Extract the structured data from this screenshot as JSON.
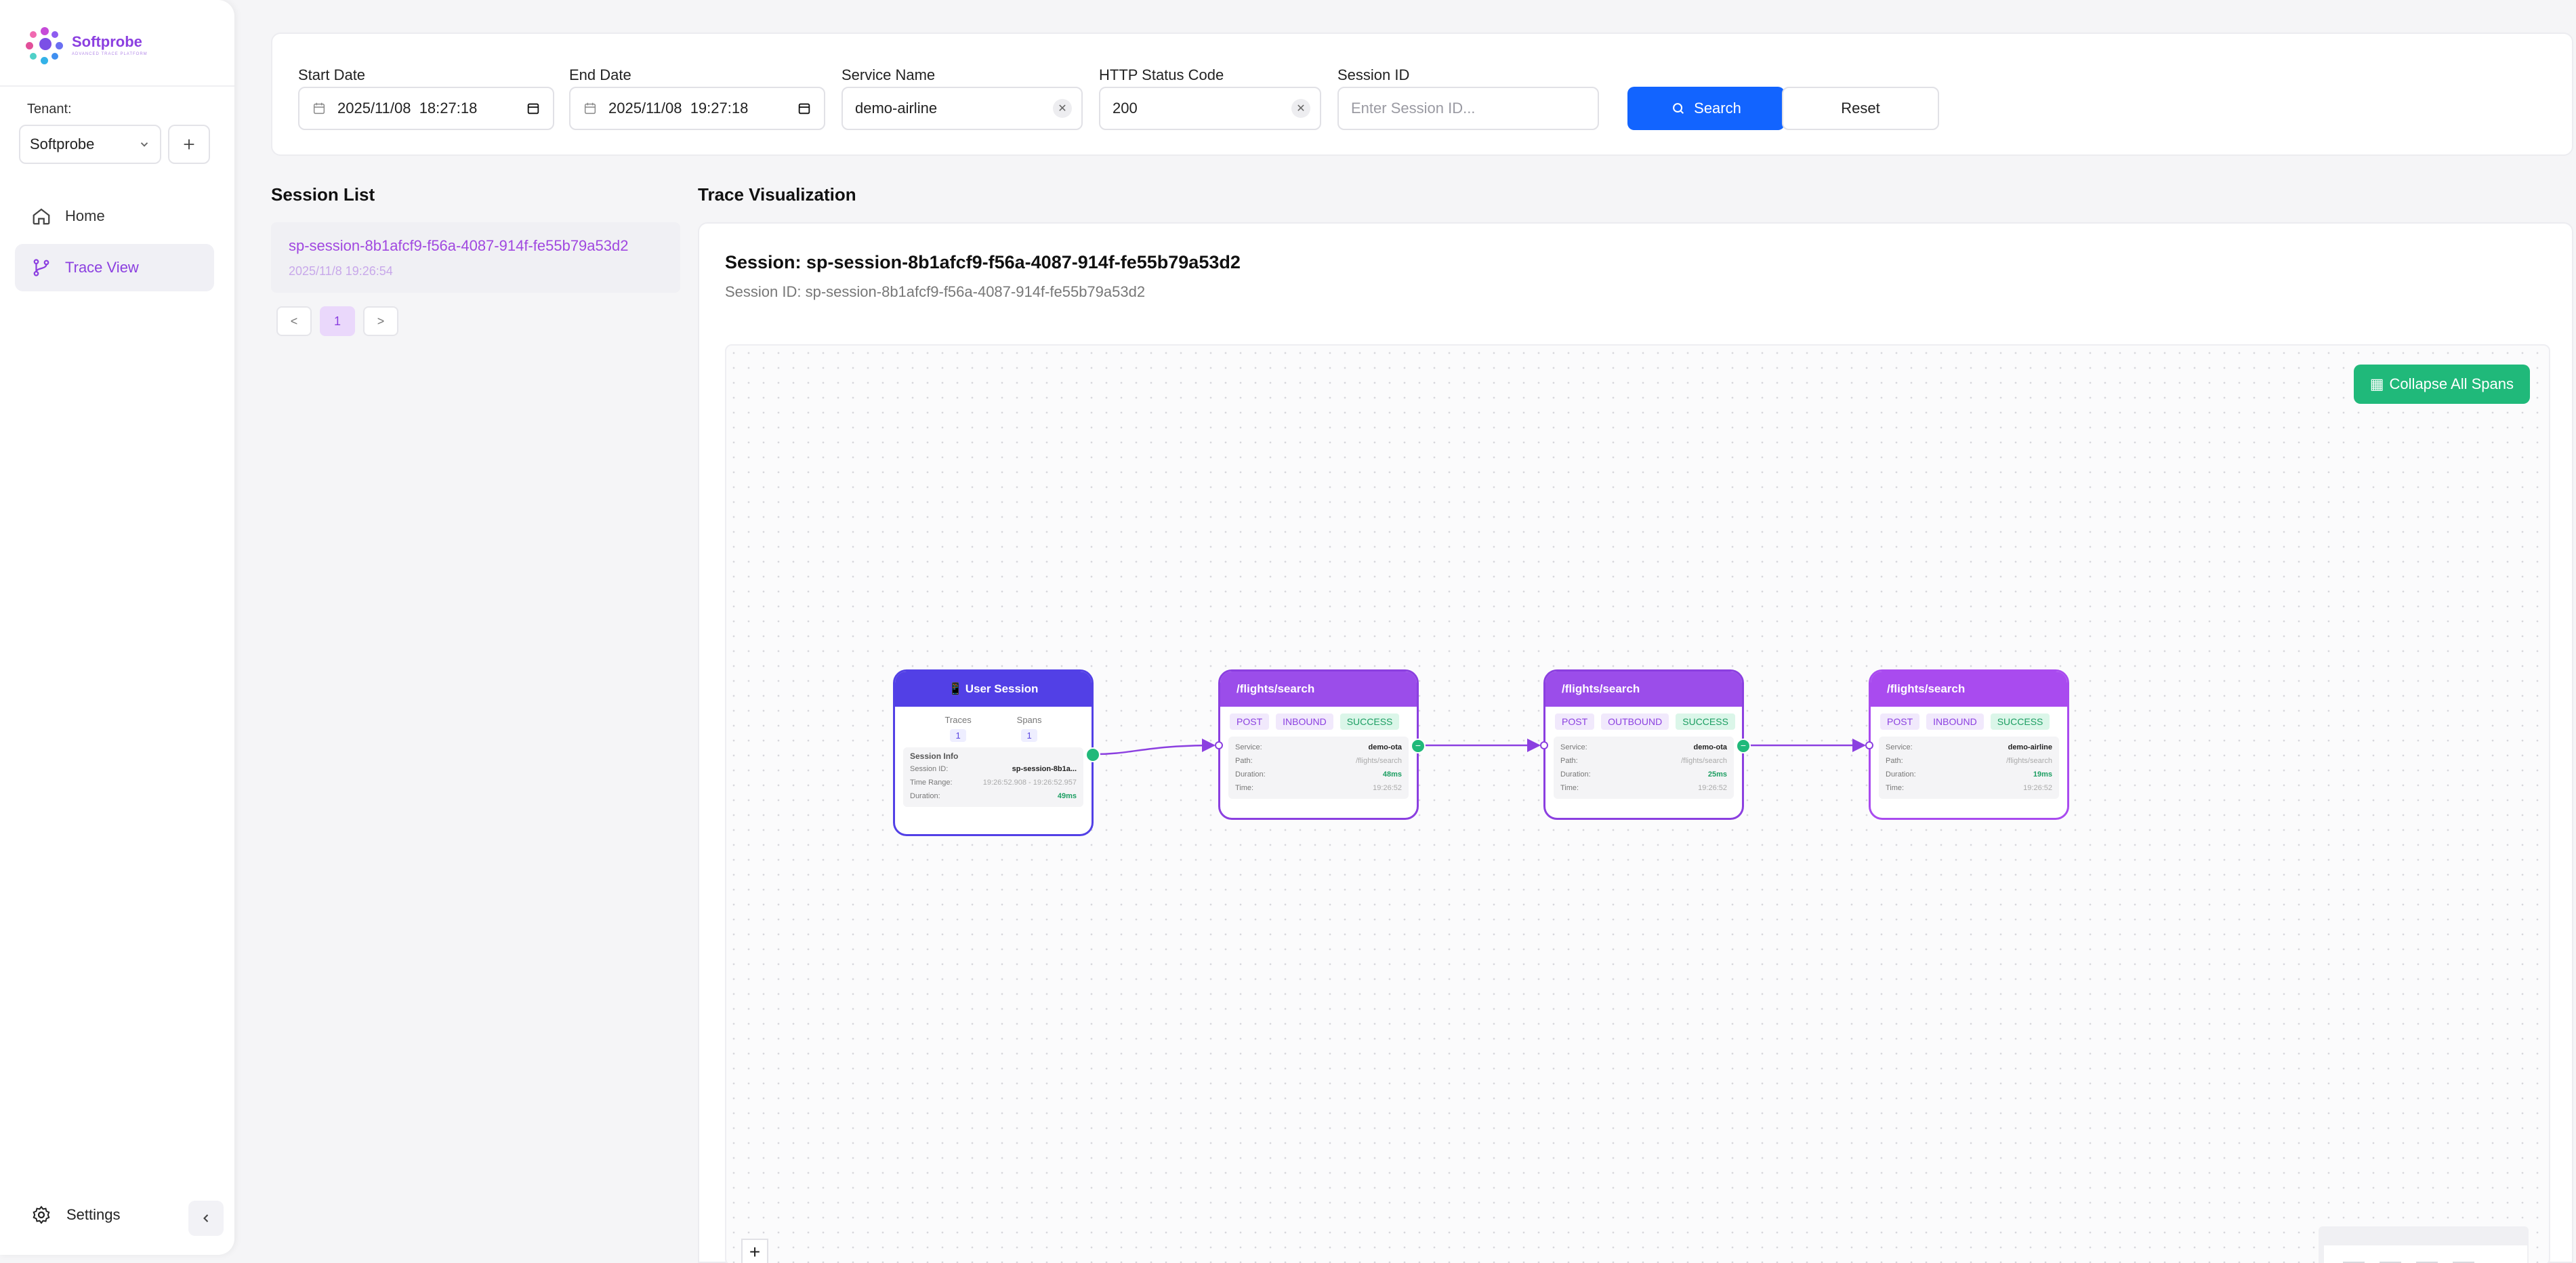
{
  "sidebar": {
    "logo_title": "Softprobe",
    "logo_subtitle": "ADVANCED TRACE PLATFORM",
    "tenant_label": "Tenant:",
    "tenant_value": "Softprobe",
    "nav": [
      {
        "label": "Home",
        "icon": "home-icon"
      },
      {
        "label": "Trace View",
        "icon": "branch-icon"
      }
    ],
    "settings_label": "Settings"
  },
  "filters": {
    "start_date_label": "Start Date",
    "start_date_value": "2025/11/08  18:27:18",
    "end_date_label": "End Date",
    "end_date_value": "2025/11/08  19:27:18",
    "service_name_label": "Service Name",
    "service_name_value": "demo-airline",
    "status_code_label": "HTTP Status Code",
    "status_code_value": "200",
    "session_id_label": "Session ID",
    "session_id_placeholder": "Enter Session ID...",
    "search_label": "Search",
    "reset_label": "Reset"
  },
  "session_list": {
    "title": "Session List",
    "items": [
      {
        "id": "sp-session-8b1afcf9-f56a-4087-914f-fe55b79a53d2",
        "time": "2025/11/8 19:26:54"
      }
    ],
    "pager": {
      "prev": "<",
      "current": "1",
      "next": ">"
    }
  },
  "trace": {
    "section_title": "Trace Visualization",
    "session_title": "Session: sp-session-8b1afcf9-f56a-4087-914f-fe55b79a53d2",
    "session_subtitle": "Session ID: sp-session-8b1afcf9-f56a-4087-914f-fe55b79a53d2",
    "collapse_all_label": "Collapse All Spans",
    "zoom_in_label": "+",
    "user_session": {
      "title": "User Session",
      "traces_label": "Traces",
      "traces_value": "1",
      "spans_label": "Spans",
      "spans_value": "1",
      "info_title": "Session Info",
      "session_id_label": "Session ID:",
      "session_id_value": "sp-session-8b1a...",
      "time_range_label": "Time Range:",
      "time_range_value": "19:26:52.908 - 19:26:52.957",
      "duration_label": "Duration:",
      "duration_value": "49ms"
    },
    "spans": [
      {
        "title": "/flights/search",
        "method": "POST",
        "direction": "INBOUND",
        "status": "SUCCESS",
        "service": "demo-ota",
        "path": "/flights/search",
        "duration": "48ms",
        "time": "19:26:52",
        "color": "#9b4dea"
      },
      {
        "title": "/flights/search",
        "method": "POST",
        "direction": "OUTBOUND",
        "status": "SUCCESS",
        "service": "demo-ota",
        "path": "/flights/search",
        "duration": "25ms",
        "time": "19:26:52",
        "color": "#9b4dea"
      },
      {
        "title": "/flights/search",
        "method": "POST",
        "direction": "INBOUND",
        "status": "SUCCESS",
        "service": "demo-airline",
        "path": "/flights/search",
        "duration": "19ms",
        "time": "19:26:52",
        "color": "#a94bef"
      }
    ],
    "labels": {
      "service": "Service:",
      "path": "Path:",
      "duration": "Duration:",
      "time": "Time:"
    }
  },
  "colors": {
    "accent": "#8b3fe0",
    "primary_button": "#1264ff",
    "success": "#20b97a",
    "user_session_head": "#5240e6"
  }
}
